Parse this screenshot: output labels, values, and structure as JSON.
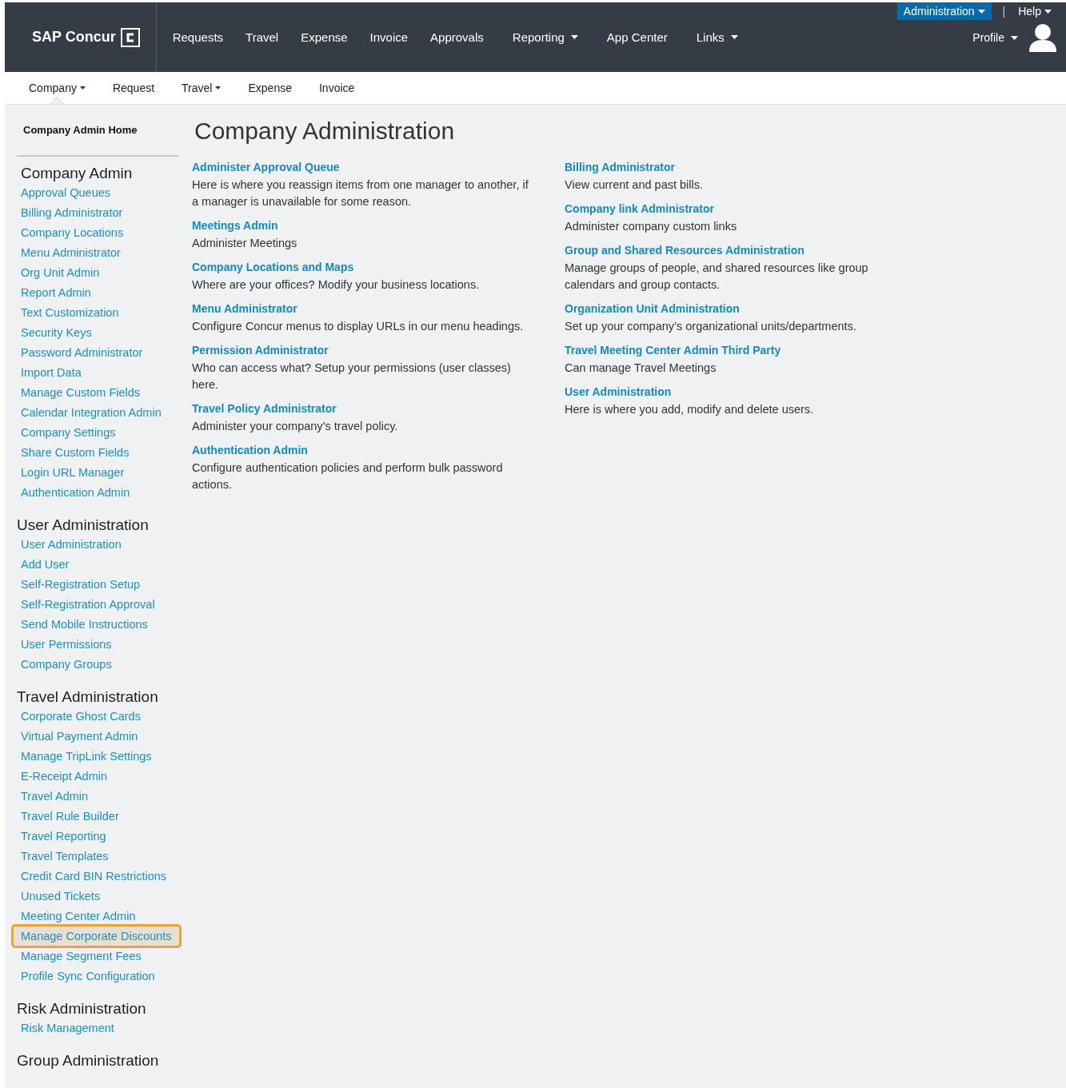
{
  "header": {
    "logo": "SAP Concur",
    "nav": [
      {
        "label": "Requests",
        "dropdown": false
      },
      {
        "label": "Travel",
        "dropdown": false
      },
      {
        "label": "Expense",
        "dropdown": false
      },
      {
        "label": "Invoice",
        "dropdown": false
      },
      {
        "label": "Approvals",
        "dropdown": false
      },
      {
        "label": "Reporting",
        "dropdown": true
      },
      {
        "label": "App Center",
        "dropdown": false
      },
      {
        "label": "Links",
        "dropdown": true
      }
    ],
    "top_links": [
      {
        "label": "Administration",
        "selected": true
      },
      {
        "label": "Help",
        "selected": false
      }
    ],
    "separator": "|",
    "profile": "Profile"
  },
  "subnav": [
    {
      "label": "Company",
      "dropdown": true,
      "selected": true
    },
    {
      "label": "Request",
      "dropdown": false,
      "selected": false
    },
    {
      "label": "Travel",
      "dropdown": true,
      "selected": false
    },
    {
      "label": "Expense",
      "dropdown": false,
      "selected": false
    },
    {
      "label": "Invoice",
      "dropdown": false,
      "selected": false
    }
  ],
  "sidebar": {
    "home": "Company Admin Home",
    "sections": [
      {
        "title": "Company Admin",
        "items": [
          {
            "label": "Approval Queues",
            "highlighted": false
          },
          {
            "label": "Billing Administrator",
            "highlighted": false
          },
          {
            "label": "Company Locations",
            "highlighted": false
          },
          {
            "label": "Menu Administrator",
            "highlighted": false
          },
          {
            "label": "Org Unit Admin",
            "highlighted": false
          },
          {
            "label": "Report Admin",
            "highlighted": false
          },
          {
            "label": "Text Customization",
            "highlighted": false
          },
          {
            "label": "Security Keys",
            "highlighted": false
          },
          {
            "label": "Password Administrator",
            "highlighted": false
          },
          {
            "label": "Import Data",
            "highlighted": false
          },
          {
            "label": "Manage Custom Fields",
            "highlighted": false
          },
          {
            "label": "Calendar Integration Admin",
            "highlighted": false
          },
          {
            "label": "Company Settings",
            "highlighted": false
          },
          {
            "label": "Share Custom Fields",
            "highlighted": false
          },
          {
            "label": "Login URL Manager",
            "highlighted": false
          },
          {
            "label": "Authentication Admin",
            "highlighted": false
          }
        ]
      },
      {
        "title": "User Administration",
        "items": [
          {
            "label": "User Administration",
            "highlighted": false
          },
          {
            "label": "Add User",
            "highlighted": false
          },
          {
            "label": "Self-Registration Setup",
            "highlighted": false
          },
          {
            "label": "Self-Registration Approval",
            "highlighted": false
          },
          {
            "label": "Send Mobile Instructions",
            "highlighted": false
          },
          {
            "label": "User Permissions",
            "highlighted": false
          },
          {
            "label": "Company Groups",
            "highlighted": false
          }
        ]
      },
      {
        "title": "Travel Administration",
        "items": [
          {
            "label": "Corporate Ghost Cards",
            "highlighted": false
          },
          {
            "label": "Virtual Payment Admin",
            "highlighted": false
          },
          {
            "label": "Manage TripLink Settings",
            "highlighted": false
          },
          {
            "label": "E-Receipt Admin",
            "highlighted": false
          },
          {
            "label": "Travel Admin",
            "highlighted": false
          },
          {
            "label": "Travel Rule Builder",
            "highlighted": false
          },
          {
            "label": "Travel Reporting",
            "highlighted": false
          },
          {
            "label": "Travel Templates",
            "highlighted": false
          },
          {
            "label": "Credit Card BIN Restrictions",
            "highlighted": false
          },
          {
            "label": "Unused Tickets",
            "highlighted": false
          },
          {
            "label": "Meeting Center Admin",
            "highlighted": false
          },
          {
            "label": "Manage Corporate Discounts",
            "highlighted": true
          },
          {
            "label": "Manage Segment Fees",
            "highlighted": false
          },
          {
            "label": "Profile Sync Configuration",
            "highlighted": false
          }
        ]
      },
      {
        "title": "Risk Administration",
        "items": [
          {
            "label": "Risk Management",
            "highlighted": false
          }
        ]
      },
      {
        "title": "Group Administration"
      }
    ]
  },
  "main": {
    "title": "Company Administration",
    "columns": [
      [
        {
          "link": "Administer Approval Queue",
          "description": "Here is where you reassign items from one manager to another, if a manager is unavailable for some reason."
        },
        {
          "link": "Meetings Admin",
          "description": "Administer Meetings"
        },
        {
          "link": "Company Locations and Maps",
          "description": "Where are your offices? Modify your business locations."
        },
        {
          "link": "Menu Administrator",
          "description": "Configure Concur menus to display URLs in our menu headings."
        },
        {
          "link": "Permission Administrator",
          "description": "Who can access what? Setup your permissions (user classes) here."
        },
        {
          "link": "Travel Policy Administrator",
          "description": "Administer your company’s travel policy."
        },
        {
          "link": "Authentication Admin",
          "description": "Configure authentication policies and perform bulk password actions."
        }
      ],
      [
        {
          "link": "Billing Administrator",
          "description": "View current and past bills."
        },
        {
          "link": "Company link Administrator",
          "description": "Administer company custom links"
        },
        {
          "link": "Group and Shared Resources Administration",
          "description": "Manage groups of people, and shared resources like group calendars and group contacts."
        },
        {
          "link": "Organization Unit Administration",
          "description": "Set up your company’s organizational units/departments."
        },
        {
          "link": "Travel Meeting Center Admin Third Party",
          "description": "Can manage Travel Meetings"
        },
        {
          "link": "User Administration",
          "description": "Here is where you add, modify and delete users."
        }
      ]
    ]
  }
}
